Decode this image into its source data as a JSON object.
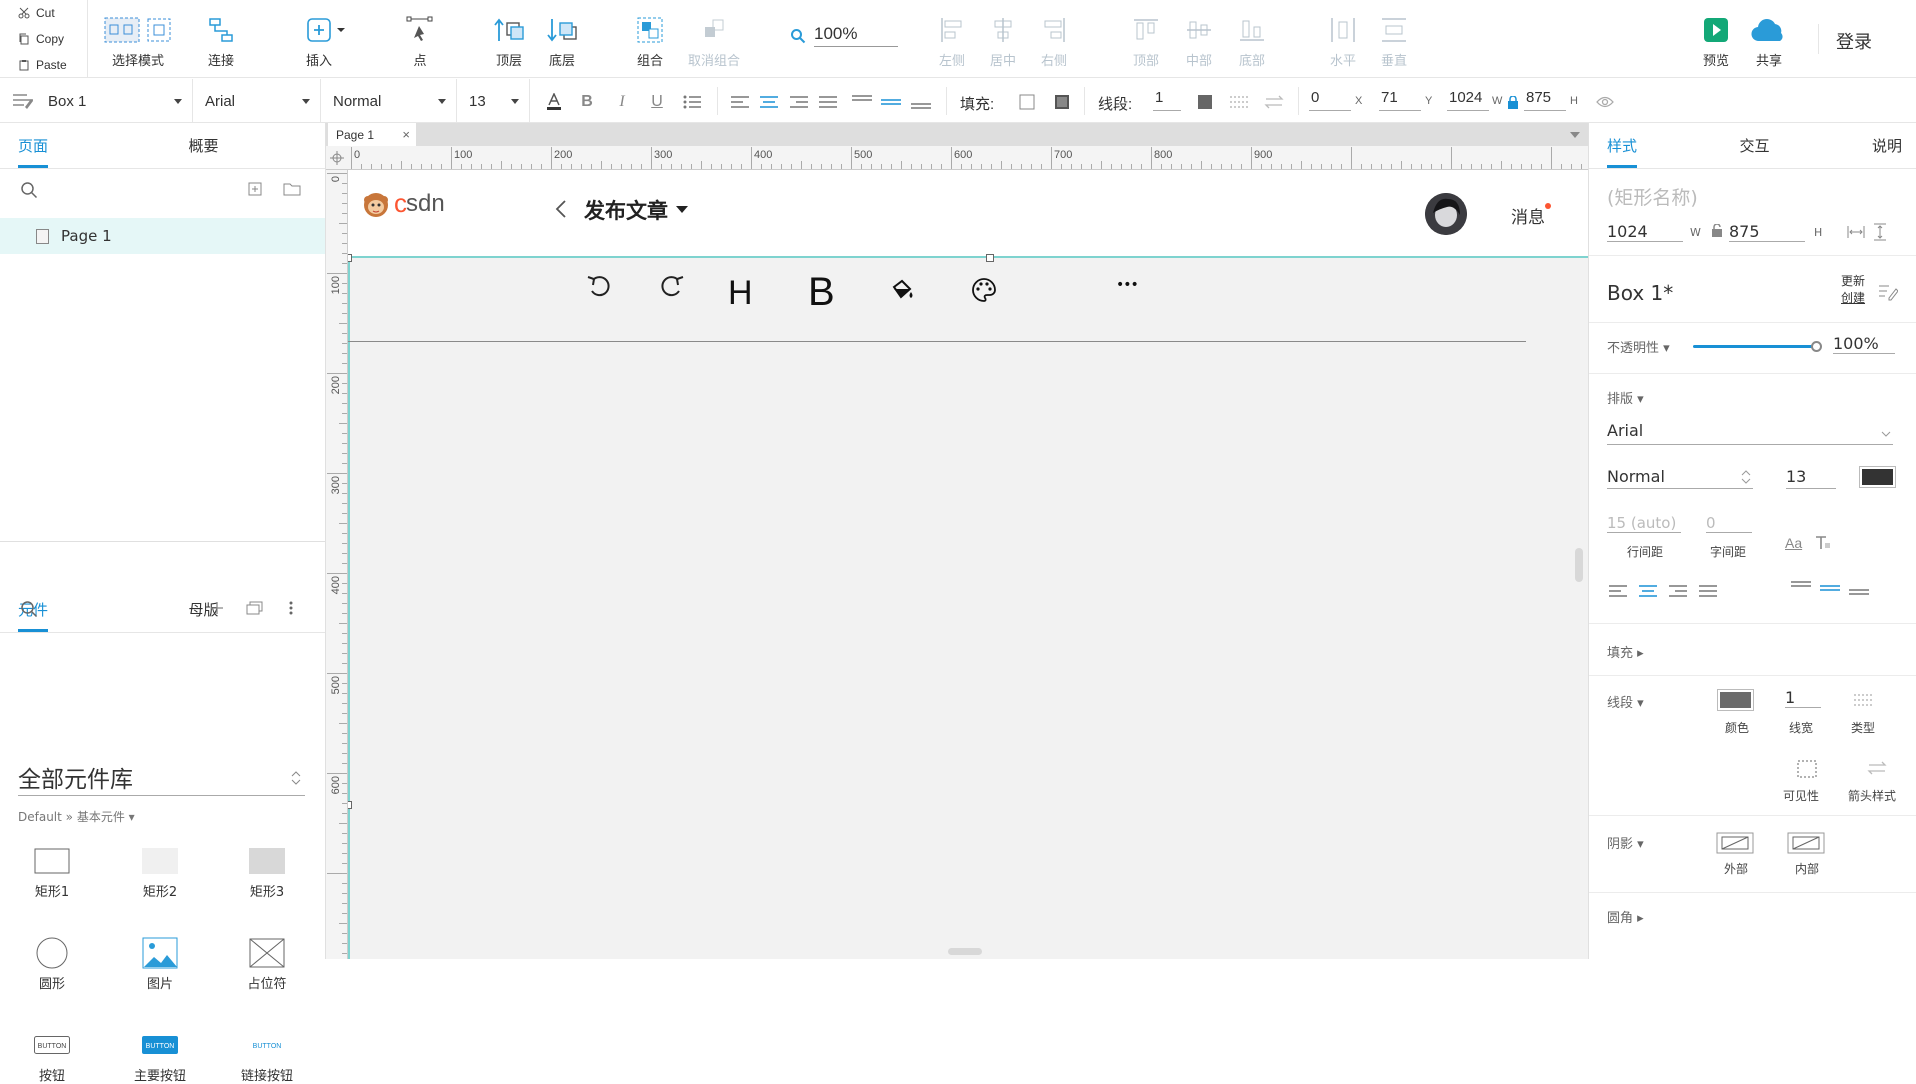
{
  "clipboard": {
    "cut": "Cut",
    "copy": "Copy",
    "paste": "Paste"
  },
  "toolbar": {
    "select_mode": "选择模式",
    "connect": "连接",
    "insert": "插入",
    "point": "点",
    "top_layer": "顶层",
    "bottom_layer": "底层",
    "group": "组合",
    "ungroup": "取消组合",
    "zoom": "100%",
    "align_left": "左侧",
    "align_center": "居中",
    "align_right": "右侧",
    "align_top": "顶部",
    "align_middle": "中部",
    "align_bottom": "底部",
    "dist_horizontal": "水平",
    "dist_vertical": "垂直",
    "preview": "预览",
    "share": "共享",
    "login": "登录"
  },
  "format_bar": {
    "shape_name": "Box 1",
    "font": "Arial",
    "weight": "Normal",
    "size": "13",
    "fill_label": "填充:",
    "stroke_label": "线段:",
    "stroke_width": "1",
    "x": "0",
    "x_label": "X",
    "y": "71",
    "y_label": "Y",
    "w": "1024",
    "w_label": "W",
    "h": "875",
    "h_label": "H"
  },
  "left_panel": {
    "tabs": [
      "页面",
      "概要"
    ],
    "pages": [
      "Page 1"
    ],
    "lib_tabs": [
      "元件",
      "母版"
    ],
    "library_title": "全部元件库",
    "library_sub": "Default » 基本元件 ▾",
    "widgets": [
      {
        "label": "矩形1",
        "icon": "rect1-icon"
      },
      {
        "label": "矩形2",
        "icon": "rect2-icon"
      },
      {
        "label": "矩形3",
        "icon": "rect3-icon"
      },
      {
        "label": "圆形",
        "icon": "circle-icon"
      },
      {
        "label": "图片",
        "icon": "image-icon"
      },
      {
        "label": "占位符",
        "icon": "placeholder-icon"
      },
      {
        "label": "按钮",
        "icon": "button-icon"
      },
      {
        "label": "主要按钮",
        "icon": "primary-button-icon"
      },
      {
        "label": "链接按钮",
        "icon": "link-button-icon"
      }
    ],
    "button_preview_text": "BUTTON"
  },
  "canvas": {
    "page_tab": "Page 1",
    "ruler_h": [
      "0",
      "100",
      "200",
      "300",
      "400",
      "500",
      "600",
      "700",
      "800",
      "900"
    ],
    "ruler_v": [
      "0",
      "100",
      "200",
      "300",
      "400",
      "500",
      "600"
    ],
    "mobile_header": {
      "logo": "CSDN",
      "title": "发布文章",
      "messages": "消息"
    },
    "editor_tools": {
      "heading": "H",
      "bold": "B",
      "more": "•••"
    }
  },
  "right_panel": {
    "tabs": [
      "样式",
      "交互",
      "说明"
    ],
    "shape_name_placeholder": "(矩形名称)",
    "w": "1024",
    "w_label": "W",
    "h": "875",
    "h_label": "H",
    "shape_label": "Box 1*",
    "update_create_1": "更新",
    "update_create_2": "创建",
    "opacity_label": "不透明性 ▾",
    "opacity": "100%",
    "typography_label": "排版 ▾",
    "font": "Arial",
    "weight": "Normal",
    "size": "13",
    "line_height": "15 (auto)",
    "letter_spacing": "0",
    "line_height_label": "行间距",
    "letter_spacing_label": "字间距",
    "fill_label": "填充 ▸",
    "stroke_label": "线段 ▾",
    "stroke_width": "1",
    "stroke_color_label": "颜色",
    "stroke_width_label": "线宽",
    "stroke_type_label": "类型",
    "visibility_label": "可见性",
    "arrow_label": "箭头样式",
    "shadow_label": "阴影 ▾",
    "shadow_outer": "外部",
    "shadow_inner": "内部",
    "corner_label": "圆角 ▸"
  },
  "colors": {
    "accent": "#1890d5",
    "teal": "#7ed3cf",
    "csdn_red": "#fc5531",
    "preview_green": "#13a877"
  }
}
